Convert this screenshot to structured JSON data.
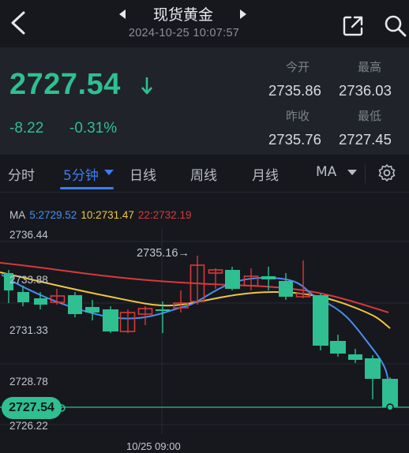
{
  "header": {
    "title": "现货黄金",
    "datetime": "2024-10-25 10:07:57"
  },
  "quote": {
    "price": "2727.54",
    "change": "-8.22",
    "change_pct": "-0.31%",
    "open_label": "今开",
    "open_value": "2735.86",
    "high_label": "最高",
    "high_value": "2736.03",
    "prev_close_label": "昨收",
    "prev_close_value": "2735.76",
    "low_label": "最低",
    "low_value": "2727.45",
    "color_down": "#2fbf91"
  },
  "tabs": [
    {
      "label": "分时"
    },
    {
      "label": "5分钟"
    },
    {
      "label": "日线"
    },
    {
      "label": "周线"
    },
    {
      "label": "月线"
    },
    {
      "label": "MA"
    }
  ],
  "chart": {
    "ma_prefix": "MA",
    "ma5": "5:2729.52",
    "ma10": "10:2731.47",
    "ma22": "22:2732.19",
    "ma5_color": "#4a8ef0",
    "ma10_color": "#f0c640",
    "ma22_color": "#d8393b",
    "y_labels": [
      "2736.44",
      "2733.88",
      "2731.33",
      "2728.78",
      "2726.22"
    ],
    "last_price": "2727.54",
    "high_annotation": "2735.16→",
    "time_label": "10/25 09:00"
  }
}
